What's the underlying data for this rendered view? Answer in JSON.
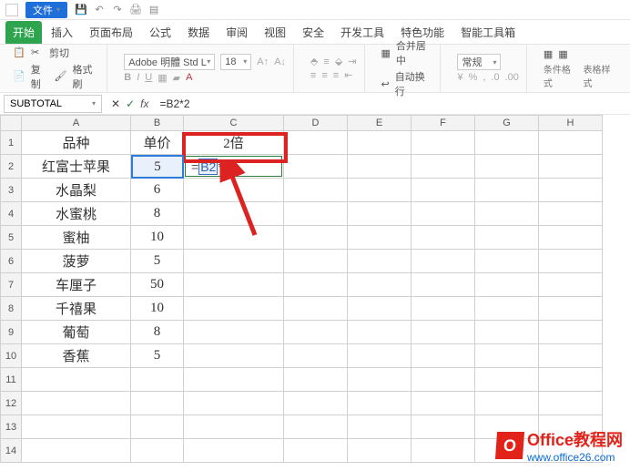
{
  "menubar": {
    "file_label": "文件",
    "qat_icons": [
      "save-icon",
      "undo-icon",
      "redo-icon",
      "print-icon",
      "preview-icon"
    ]
  },
  "tabs": [
    "开始",
    "插入",
    "页面布局",
    "公式",
    "数据",
    "审阅",
    "视图",
    "安全",
    "开发工具",
    "特色功能",
    "智能工具箱"
  ],
  "ribbon": {
    "clipboard": {
      "cut": "剪切",
      "copy": "复制",
      "format_painter": "格式刷"
    },
    "font": {
      "name": "Adobe 明體 Std L",
      "size": "18",
      "bold": "B",
      "italic": "I",
      "underline": "U"
    },
    "align": {
      "merge": "合并居中",
      "wrap": "自动换行"
    },
    "number": {
      "format": "常规"
    },
    "styles": {
      "cond": "条件格式",
      "table": "表格样式"
    }
  },
  "namebar": {
    "name": "SUBTOTAL",
    "cancel": "✕",
    "confirm": "✓",
    "fx": "fx",
    "formula": "=B2*2"
  },
  "grid": {
    "cols": [
      "A",
      "B",
      "C",
      "D",
      "E",
      "F",
      "G",
      "H"
    ],
    "rows": [
      "1",
      "2",
      "3",
      "4",
      "5",
      "6",
      "7",
      "8",
      "9",
      "10",
      "11",
      "12",
      "13",
      "14"
    ],
    "headers": {
      "A": "品种",
      "B": "单价",
      "C": "2倍"
    },
    "data": {
      "A": [
        "红富士苹果",
        "水晶梨",
        "水蜜桃",
        "蜜柚",
        "菠萝",
        "车厘子",
        "千禧果",
        "葡萄",
        "香蕉"
      ],
      "B": [
        "5",
        "6",
        "8",
        "10",
        "5",
        "50",
        "10",
        "8",
        "5"
      ]
    },
    "c2_parts": {
      "eq": "=",
      "ref": "B2",
      "rest": "*2"
    }
  },
  "watermark": {
    "line1": "Office教程网",
    "line2": "www.office26.com"
  }
}
